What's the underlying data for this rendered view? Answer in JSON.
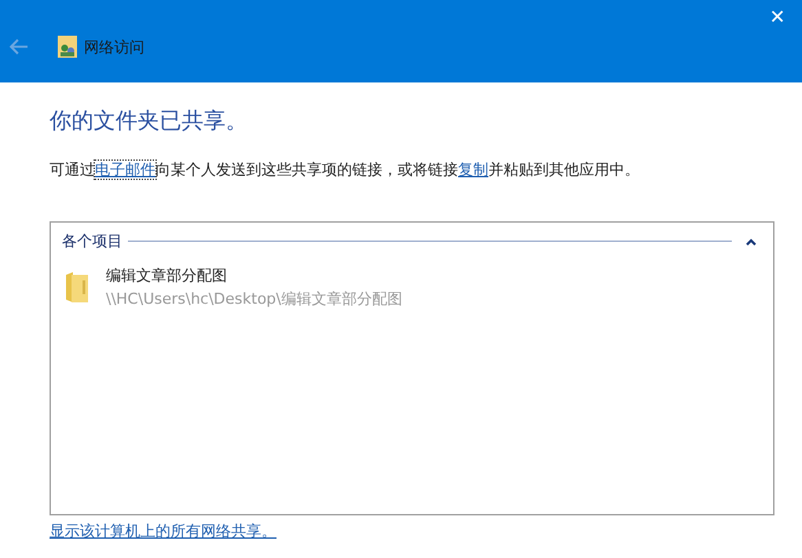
{
  "window": {
    "title": "网络访问",
    "close": "✕"
  },
  "heading": "你的文件夹已共享。",
  "description": [
    {
      "kind": "text",
      "text": "可通过"
    },
    {
      "kind": "link",
      "text": "电子邮件",
      "focused": true
    },
    {
      "kind": "text",
      "text": "向某个人发送到这些共享项的链接，或将链接"
    },
    {
      "kind": "link",
      "text": "复制",
      "focused": false
    },
    {
      "kind": "text",
      "text": "并粘贴到其他应用中。"
    }
  ],
  "group": {
    "title": "各个项目",
    "expanded": true,
    "items": [
      {
        "name": "编辑文章部分配图",
        "path": "\\\\HC\\Users\\hc\\Desktop\\编辑文章部分配图"
      }
    ]
  },
  "footer_link": "显示该计算机上的所有网络共享。"
}
